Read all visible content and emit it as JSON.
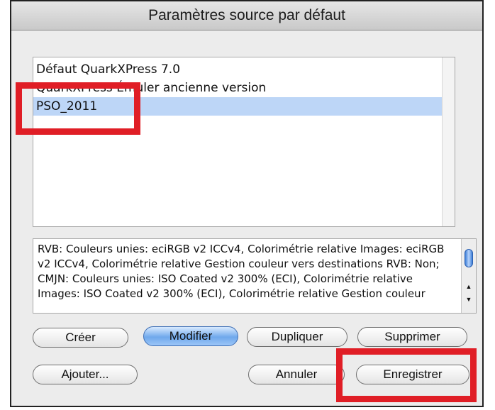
{
  "window": {
    "title": "Paramètres source par défaut"
  },
  "source_list": {
    "items": [
      {
        "label": "Défaut QuarkXPress 7.0",
        "selected": false
      },
      {
        "label": "QuarkXPress Émuler ancienne version",
        "selected": false
      },
      {
        "label": "PSO_2011",
        "selected": true
      }
    ]
  },
  "description": {
    "text": "RVB: Couleurs unies: eciRGB v2 ICCv4, Colorimétrie relative Images: eciRGB v2 ICCv4, Colorimétrie relative Gestion couleur vers destinations RVB: Non; CMJN: Couleurs unies: ISO Coated v2 300% (ECI), Colorimétrie relative Images: ISO Coated v2 300% (ECI), Colorimétrie relative Gestion couleur"
  },
  "buttons": {
    "create": "Créer",
    "modify": "Modifier",
    "duplicate": "Dupliquer",
    "delete": "Supprimer",
    "add": "Ajouter...",
    "cancel": "Annuler",
    "save": "Enregistrer"
  },
  "colors": {
    "highlight": "#e01e26",
    "selection": "#bdd6f7",
    "default_button": "#6fa8ec"
  }
}
